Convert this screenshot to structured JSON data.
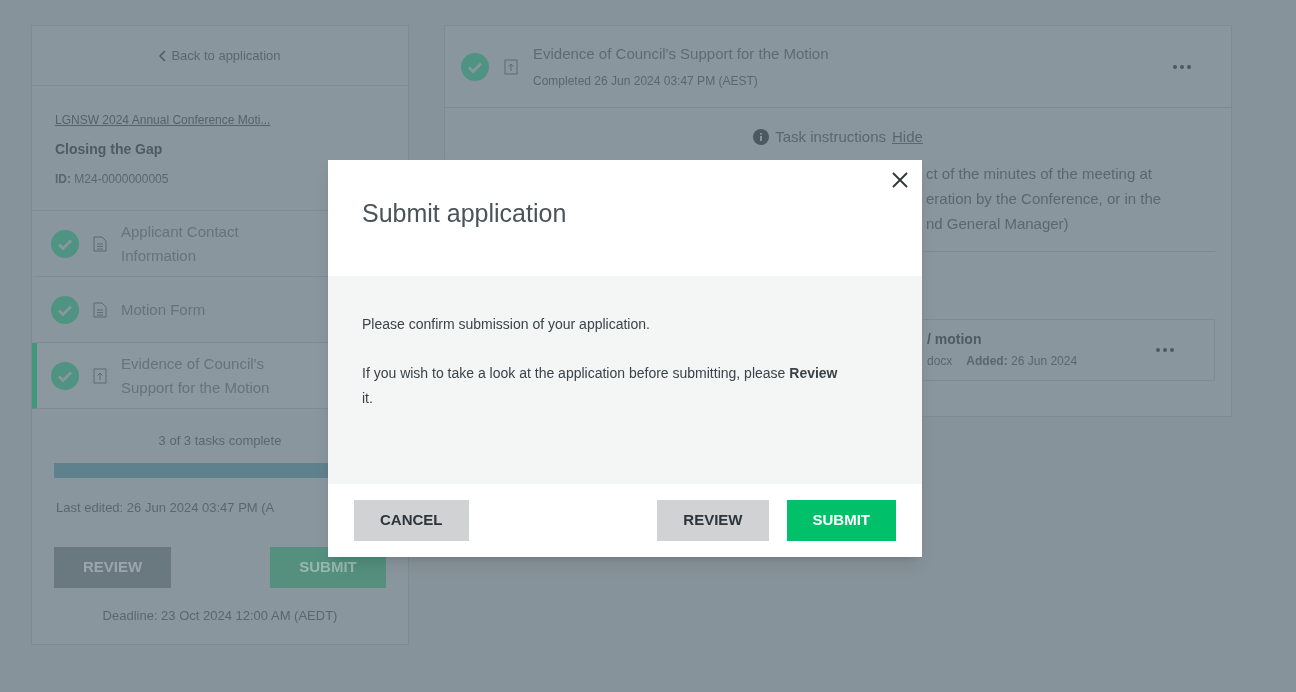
{
  "sidebar": {
    "back_link": "Back to application",
    "application_link": "LGNSW 2024 Annual Conference Moti...",
    "title": "Closing the Gap",
    "id_label": "ID:",
    "id_value": "M24-0000000005",
    "tasks": [
      {
        "kind": "form",
        "label": "Applicant Contact Information",
        "complete": true,
        "selected": false
      },
      {
        "kind": "form",
        "label": "Motion Form",
        "complete": true,
        "selected": false
      },
      {
        "kind": "upload",
        "label": "Evidence of Council's Support for the Motion",
        "complete": true,
        "selected": true
      }
    ],
    "progress_text": "3 of 3 tasks complete",
    "progress": {
      "level": 1
    },
    "last_edited": "Last edited: 26 Jun 2024 03:47 PM (A",
    "buttons": [
      "REVIEW",
      "SUBMIT"
    ],
    "deadline": "Deadline: 23 Oct 2024 12:00 AM (AEDT)"
  },
  "task": {
    "title": "Evidence of Council's Support for the Motion",
    "status": "Completed 26 Jun 2024 03:47 PM (AEST)",
    "instructions_label": "Task instructions",
    "instructions_toggle": "Hide",
    "instructions_lines": [
      "ct of the minutes of the meeting at",
      "eration by the Conference, or in the",
      "nd General Manager)"
    ],
    "file": {
      "name": "/ motion",
      "type": "docx",
      "added_label": "Added:",
      "added_value": "26 Jun 2024"
    }
  },
  "dialog": {
    "title": "Submit application",
    "paragraphs": [
      "Please confirm submission of your application.",
      "If you wish to take a look at the application before submitting, please **Review** it."
    ],
    "buttons": [
      {
        "kind": "cancel",
        "label": "CANCEL"
      },
      {
        "kind": "secondary",
        "label": "REVIEW"
      },
      {
        "kind": "primary",
        "label": "SUBMIT"
      }
    ]
  }
}
